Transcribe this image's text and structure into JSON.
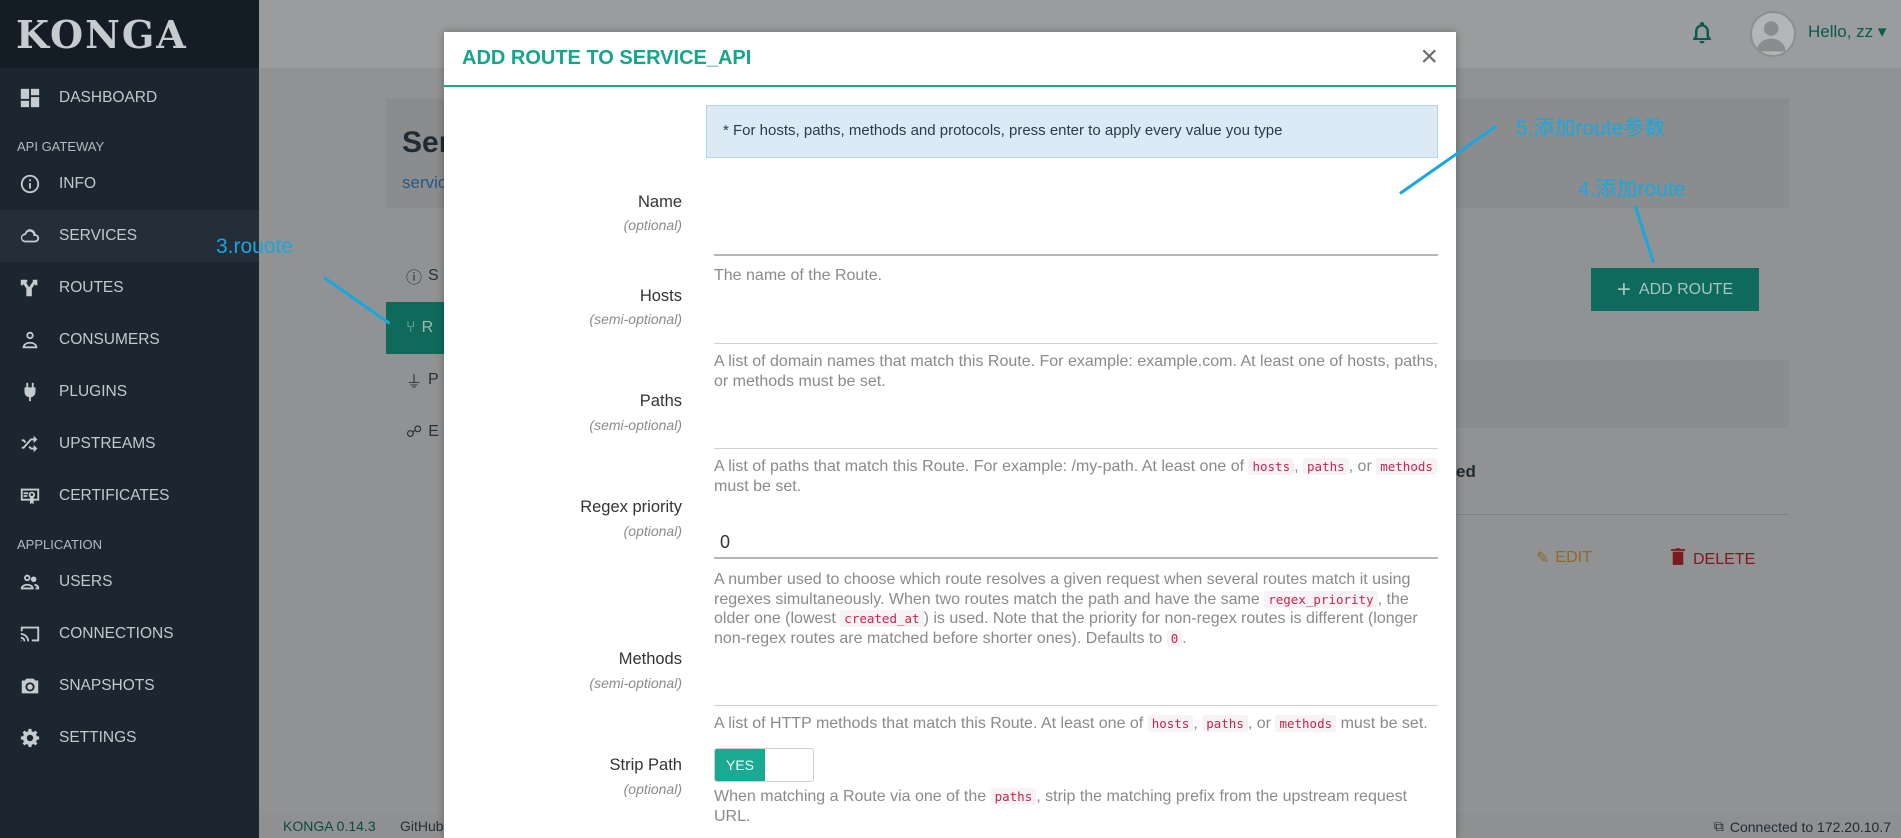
{
  "sidebar": {
    "logo": "KONGA",
    "items": [
      {
        "label": "DASHBOARD",
        "icon": "dashboard-icon"
      },
      {
        "section": "API GATEWAY"
      },
      {
        "label": "INFO",
        "icon": "info-icon"
      },
      {
        "label": "SERVICES",
        "icon": "cloud-icon",
        "active": true
      },
      {
        "label": "ROUTES",
        "icon": "routes-icon"
      },
      {
        "label": "CONSUMERS",
        "icon": "user-icon"
      },
      {
        "label": "PLUGINS",
        "icon": "plug-icon"
      },
      {
        "label": "UPSTREAMS",
        "icon": "shuffle-icon"
      },
      {
        "label": "CERTIFICATES",
        "icon": "certificate-icon"
      },
      {
        "section": "APPLICATION"
      },
      {
        "label": "USERS",
        "icon": "users-icon"
      },
      {
        "label": "CONNECTIONS",
        "icon": "connections-icon"
      },
      {
        "label": "SNAPSHOTS",
        "icon": "camera-icon"
      },
      {
        "label": "SETTINGS",
        "icon": "gear-icon"
      }
    ]
  },
  "topbar": {
    "greeting": "Hello, zz",
    "caret": "▾"
  },
  "background": {
    "title": "Ser",
    "link": "servic",
    "subnav": [
      {
        "label": "S",
        "icon": "info-icon"
      },
      {
        "label": "R",
        "icon": "routes-icon",
        "active": true
      },
      {
        "label": "P",
        "icon": "plug-icon"
      },
      {
        "label": "E",
        "icon": "users-icon"
      }
    ],
    "add_route": "ADD ROUTE",
    "ed_text": "ed",
    "edit": "EDIT",
    "delete": "DELETE"
  },
  "footer": {
    "version": "KONGA 0.14.3",
    "github": "GitHub",
    "connection": "Connected to 172.20.10.7"
  },
  "annotations": {
    "a3": "3.rouote",
    "a4": "4.添加route",
    "a5": "5.添加route参数"
  },
  "modal": {
    "title": "ADD ROUTE TO SERVICE_API",
    "close": "×",
    "info": "* For hosts, paths, methods and protocols, press enter to apply every value you type",
    "fields": {
      "name": {
        "label": "Name",
        "opt": "(optional)",
        "value": "",
        "help": "The name of the Route."
      },
      "hosts": {
        "label": "Hosts",
        "opt": "(semi-optional)",
        "value": "",
        "help": "A list of domain names that match this Route. For example: example.com. At least one of hosts, paths, or methods must be set."
      },
      "paths": {
        "label": "Paths",
        "opt": "(semi-optional)",
        "value": "",
        "help_a": "A list of paths that match this Route. For example: /my-path. At least one of ",
        "code1": "hosts",
        "sep1": ", ",
        "code2": "paths",
        "sep2": ", or ",
        "code3": "methods",
        "help_b": " must be set."
      },
      "regex": {
        "label": "Regex priority",
        "opt": "(optional)",
        "value": "0",
        "help_a": "A number used to choose which route resolves a given request when several routes match it using regexes simultaneously. When two routes match the path and have the same ",
        "code1": "regex_priority",
        "help_b": ", the older one (lowest ",
        "code2": "created_at",
        "help_c": ") is used. Note that the priority for non-regex routes is different (longer non-regex routes are matched before shorter ones). Defaults to ",
        "code3": "0",
        "help_d": "."
      },
      "methods": {
        "label": "Methods",
        "opt": "(semi-optional)",
        "value": "",
        "help_a": "A list of HTTP methods that match this Route. At least one of ",
        "code1": "hosts",
        "sep1": ", ",
        "code2": "paths",
        "sep2": ", or ",
        "code3": "methods",
        "help_b": " must be set."
      },
      "strip": {
        "label": "Strip Path",
        "opt": "(optional)",
        "toggle": "YES",
        "help_a": "When matching a Route via one of the ",
        "code1": "paths",
        "help_b": ", strip the matching prefix from the upstream request URL."
      }
    }
  },
  "colors": {
    "accent": "#14a58b",
    "sidebar": "#1c2630",
    "annotation": "#19a7e0"
  }
}
